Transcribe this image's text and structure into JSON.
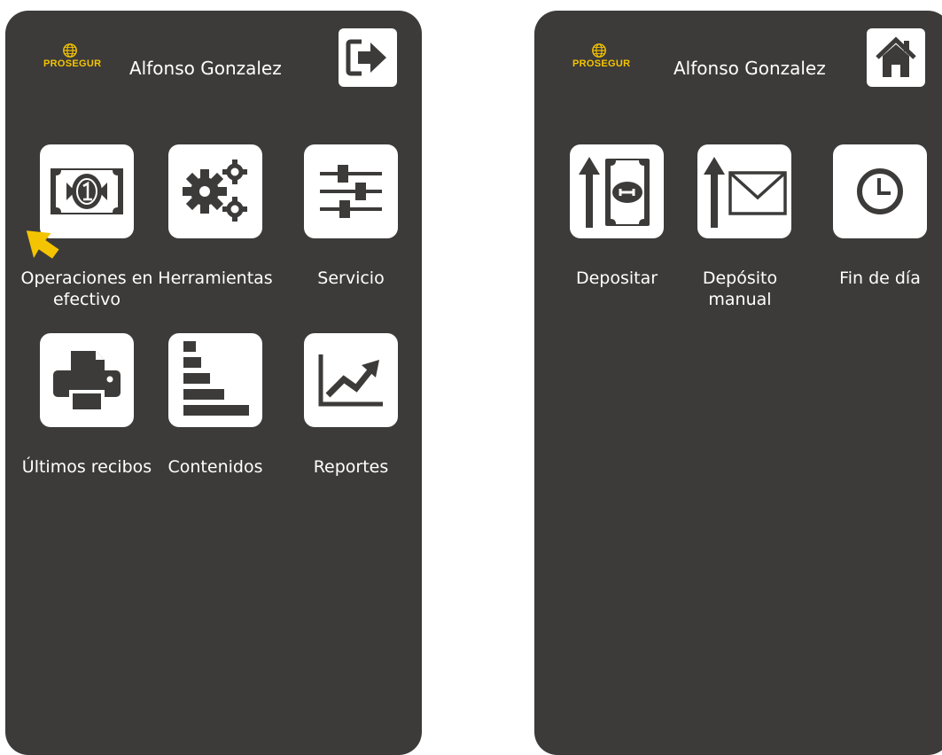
{
  "left_screen": {
    "brand": "PROSEGUR",
    "user_name": "Alfonso Gonzalez",
    "top_button_icon": "logout-icon",
    "menu": [
      {
        "label": "Operaciones en efectivo",
        "icon": "cash-note-icon"
      },
      {
        "label": "Herramientas",
        "icon": "gears-icon"
      },
      {
        "label": "Servicio",
        "icon": "sliders-icon"
      },
      {
        "label": "Últimos recibos",
        "icon": "printer-icon"
      },
      {
        "label": "Contenidos",
        "icon": "bar-chart-icon"
      },
      {
        "label": "Reportes",
        "icon": "trend-chart-icon"
      }
    ]
  },
  "right_screen": {
    "brand": "PROSEGUR",
    "user_name": "Alfonso Gonzalez",
    "top_button_icon": "home-icon",
    "menu": [
      {
        "label": "Depositar",
        "icon": "deposit-note-icon"
      },
      {
        "label": "Depósito manual",
        "icon": "deposit-envelope-icon"
      },
      {
        "label": "Fin de día",
        "icon": "clock-icon"
      }
    ]
  },
  "colors": {
    "screen_bg": "#3c3b3a",
    "tile_bg": "#ffffff",
    "icon": "#3c3b3a",
    "brand": "#f5c400",
    "cursor": "#f5c400"
  }
}
